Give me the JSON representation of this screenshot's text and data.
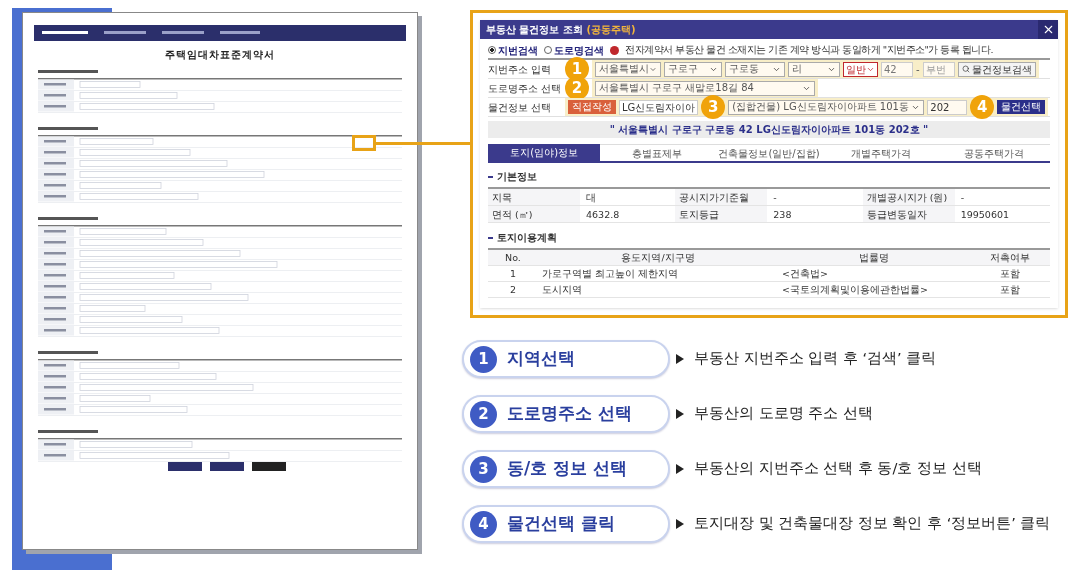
{
  "document_thumbnail": {
    "title": "주택임대차표준계약서"
  },
  "dialog": {
    "title": "부동산 물건정보 조회",
    "title_suffix": "(공동주택)",
    "search_modes": [
      {
        "label": "지번검색",
        "selected": true
      },
      {
        "label": "도로명검색",
        "selected": false
      }
    ],
    "notice": "전자계약서 부동산 물건 소재지는 기존 계약 방식과 동일하게 \"지번주소\"가 등록 됩니다.",
    "parcel_address": {
      "label": "지번주소 입력",
      "step": "1",
      "selects": [
        "서울특별시",
        "구로구",
        "구로동",
        "리"
      ],
      "land_type": "일반",
      "main_number": "42",
      "separator": "-",
      "sub_number_placeholder": "부번",
      "search_button": "물건정보검색"
    },
    "road_address": {
      "label": "도로명주소 선택",
      "step": "2",
      "value": "서울특별시 구로구 새말로18길 84"
    },
    "property": {
      "label": "물건정보 선택",
      "direct_button": "직접작성",
      "complex": "LG신도림자이아",
      "step_building": "3",
      "building": "(집합건물) LG신도림자이아파트 101동",
      "unit": "202",
      "step_select": "4",
      "select_button": "물건선택"
    },
    "selected_address": "\" 서울특별시 구로구 구로동 42 LG신도림자이아파트 101동 202호 \"",
    "tabs": [
      {
        "label": "토지(임야)정보",
        "selected": true
      },
      {
        "label": "층별표제부",
        "selected": false
      },
      {
        "label": "건축물정보(일반/집합)",
        "selected": false
      },
      {
        "label": "개별주택가격",
        "selected": false
      },
      {
        "label": "공동주택가격",
        "selected": false
      }
    ],
    "basic_info": {
      "heading": "기본정보",
      "rows": [
        [
          {
            "label": "지목",
            "value": "대"
          },
          {
            "label": "공시지가기준월",
            "value": "-"
          },
          {
            "label": "개별공시지가 (원)",
            "value": "-"
          }
        ],
        [
          {
            "label": "면적 (㎡)",
            "value": "4632.8"
          },
          {
            "label": "토지등급",
            "value": "238"
          },
          {
            "label": "등급변동일자",
            "value": "19950601"
          }
        ]
      ]
    },
    "land_use": {
      "heading": "토지이용계획",
      "columns": [
        "No.",
        "용도지역/지구명",
        "법률명",
        "저촉여부"
      ],
      "rows": [
        [
          "1",
          "가로구역별 최고높이 제한지역",
          "<건축법>",
          "포함"
        ],
        [
          "2",
          "도시지역",
          "<국토의계획및이용에관한법률>",
          "포함"
        ]
      ]
    }
  },
  "steps": [
    {
      "number": "1",
      "title": "지역선택",
      "description": "부동산 지번주소 입력 후 ‘검색’ 클릭"
    },
    {
      "number": "2",
      "title": "도로명주소 선택",
      "description": "부동산의 도로명 주소 선택"
    },
    {
      "number": "3",
      "title": "동/호 정보 선택",
      "description": "부동산의 지번주소 선택 후 동/호 정보 선택"
    },
    {
      "number": "4",
      "title": "물건선택 클릭",
      "description": "토지대장 및 건축물대장 정보 확인 후 ‘정보버튼’ 클릭"
    }
  ]
}
